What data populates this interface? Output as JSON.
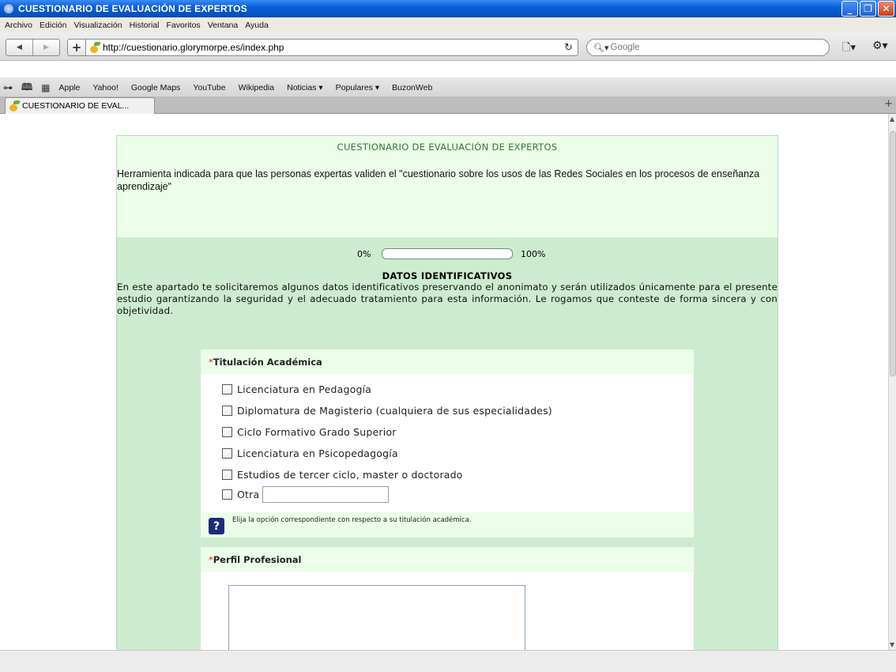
{
  "window": {
    "title": "CUESTIONARIO DE EVALUACIÓN DE EXPERTOS"
  },
  "menu": [
    "Archivo",
    "Edición",
    "Visualización",
    "Historial",
    "Favoritos",
    "Ventana",
    "Ayuda"
  ],
  "toolbar": {
    "url": "http://cuestionario.glorymorpe.es/index.php",
    "search_placeholder": "Google"
  },
  "bookmarks": [
    "Apple",
    "Yahoo!",
    "Google Maps",
    "YouTube",
    "Wikipedia",
    "Noticias ▾",
    "Populares ▾",
    "BuzonWeb"
  ],
  "tab": {
    "label": "CUESTIONARIO DE EVAL..."
  },
  "page": {
    "title": "CUESTIONARIO DE EVALUACIÓN DE EXPERTOS",
    "description": "Herramienta indicada para que las personas expertas validen el \"cuestionario sobre los usos de las Redes Sociales en los procesos de enseñanza aprendizaje\"",
    "progress": {
      "left_label": "0%",
      "right_label": "100%",
      "value": 0
    },
    "section": {
      "title": "DATOS IDENTIFICATIVOS",
      "text": "En este apartado te solicitaremos algunos datos identificativos preservando el anonimato y serán utilizados únicamente para el presente estudio garantizando la seguridad y el adecuado tratamiento para esta información. Le rogamos que conteste de forma sincera y con objetividad."
    },
    "q1": {
      "required_mark": "*",
      "label": "Titulación Académica",
      "options": [
        "Licenciatura en Pedagogía",
        "Diplomatura de Magisterio (cualquiera de sus especialidades)",
        "Ciclo Formativo Grado Superior",
        "Licenciatura en Psicopedagogía",
        "Estudios de tercer ciclo, master o doctorado",
        "Otra"
      ],
      "hint": "Elija la opción correspondiente con respecto a su titulación académica."
    },
    "q2": {
      "required_mark": "*",
      "label": "Perfil Profesional"
    }
  }
}
